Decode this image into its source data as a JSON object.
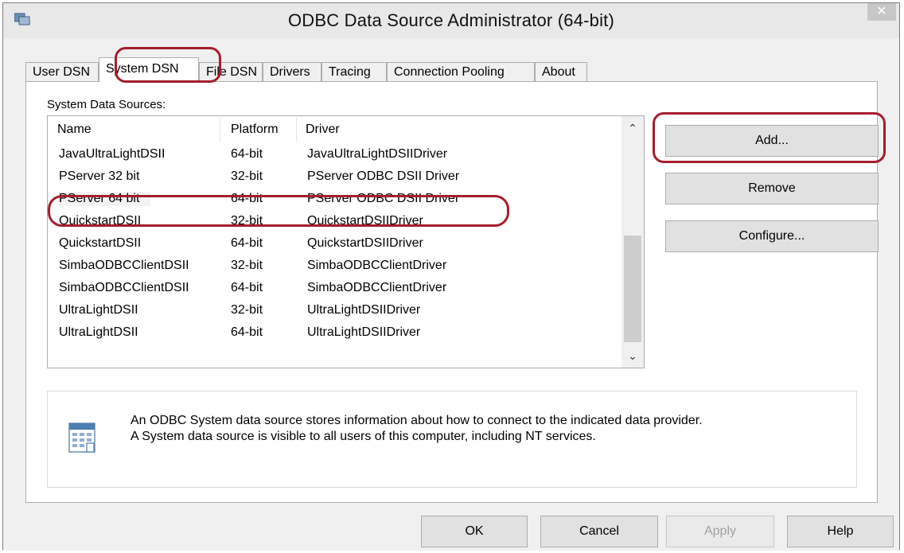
{
  "window": {
    "title": "ODBC Data Source Administrator (64-bit)",
    "close_glyph": "✕"
  },
  "tabs": [
    {
      "label": "User DSN"
    },
    {
      "label": "System DSN",
      "active": true
    },
    {
      "label": "File DSN"
    },
    {
      "label": "Drivers"
    },
    {
      "label": "Tracing"
    },
    {
      "label": "Connection Pooling"
    },
    {
      "label": "About"
    }
  ],
  "section_label": "System Data Sources:",
  "columns": {
    "name": "Name",
    "platform": "Platform",
    "driver": "Driver"
  },
  "rows": [
    {
      "name": "JavaUltraLightDSII",
      "platform": "64-bit",
      "driver": "JavaUltraLightDSIIDriver"
    },
    {
      "name": "PServer 32 bit",
      "platform": "32-bit",
      "driver": "PServer ODBC DSII Driver"
    },
    {
      "name": "PServer 64 bit",
      "platform": "64-bit",
      "driver": "PServer ODBC DSII Driver"
    },
    {
      "name": "QuickstartDSII",
      "platform": "32-bit",
      "driver": "QuickstartDSIIDriver"
    },
    {
      "name": "QuickstartDSII",
      "platform": "64-bit",
      "driver": "QuickstartDSIIDriver"
    },
    {
      "name": "SimbaODBCClientDSII",
      "platform": "32-bit",
      "driver": "SimbaODBCClientDriver"
    },
    {
      "name": "SimbaODBCClientDSII",
      "platform": "64-bit",
      "driver": "SimbaODBCClientDriver"
    },
    {
      "name": "UltraLightDSII",
      "platform": "32-bit",
      "driver": "UltraLightDSIIDriver"
    },
    {
      "name": "UltraLightDSII",
      "platform": "64-bit",
      "driver": "UltraLightDSIIDriver"
    }
  ],
  "scroll": {
    "up_glyph": "⌃",
    "down_glyph": "⌄"
  },
  "side_buttons": {
    "add": "Add...",
    "remove": "Remove",
    "configure": "Configure..."
  },
  "info": {
    "line1": "An ODBC System data source stores information about how to connect to the indicated data provider.",
    "line2": "A System data source is visible to all users of this computer, including NT services."
  },
  "footer_buttons": {
    "ok": "OK",
    "cancel": "Cancel",
    "apply": "Apply",
    "help": "Help"
  },
  "colors": {
    "highlight": "#a51d2d",
    "button_face": "#e1e1e1",
    "dialog_bg": "#f0f0f0"
  },
  "icons": {
    "app": "odbc-admin-icon",
    "info": "data-source-icon"
  }
}
